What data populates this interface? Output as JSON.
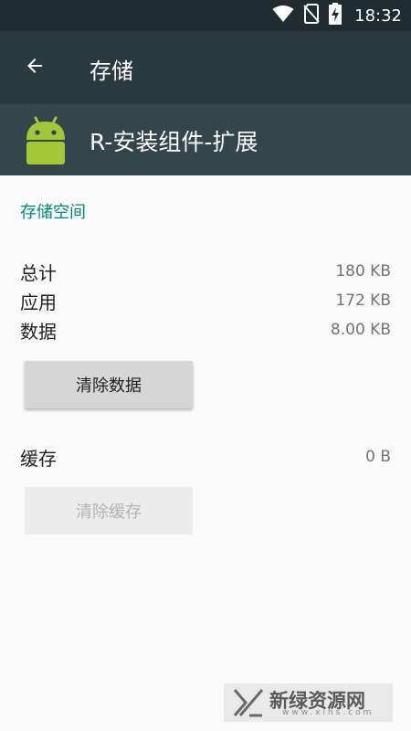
{
  "status_bar": {
    "time": "18:32",
    "icons": [
      "wifi-icon",
      "no-sim-icon",
      "battery-charging-icon"
    ]
  },
  "toolbar": {
    "back_icon": "arrow-back-icon",
    "title": "存储"
  },
  "app_header": {
    "icon": "android-robot-icon",
    "app_name": "R-安装组件-扩展"
  },
  "storage": {
    "section_title": "存储空间",
    "rows": [
      {
        "label": "总计",
        "value": "180 KB"
      },
      {
        "label": "应用",
        "value": "172 KB"
      },
      {
        "label": "数据",
        "value": "8.00 KB"
      }
    ],
    "clear_data_label": "清除数据"
  },
  "cache": {
    "label": "缓存",
    "value": "0 B",
    "clear_cache_label": "清除缓存"
  },
  "watermark": {
    "text": "新绿资源网",
    "subtext": "www.xlhs.com"
  },
  "colors": {
    "status_bar": "#1f2c32",
    "toolbar": "#2b3a40",
    "app_header": "#34454c",
    "accent": "#00897b",
    "android_green": "#a4c639"
  }
}
